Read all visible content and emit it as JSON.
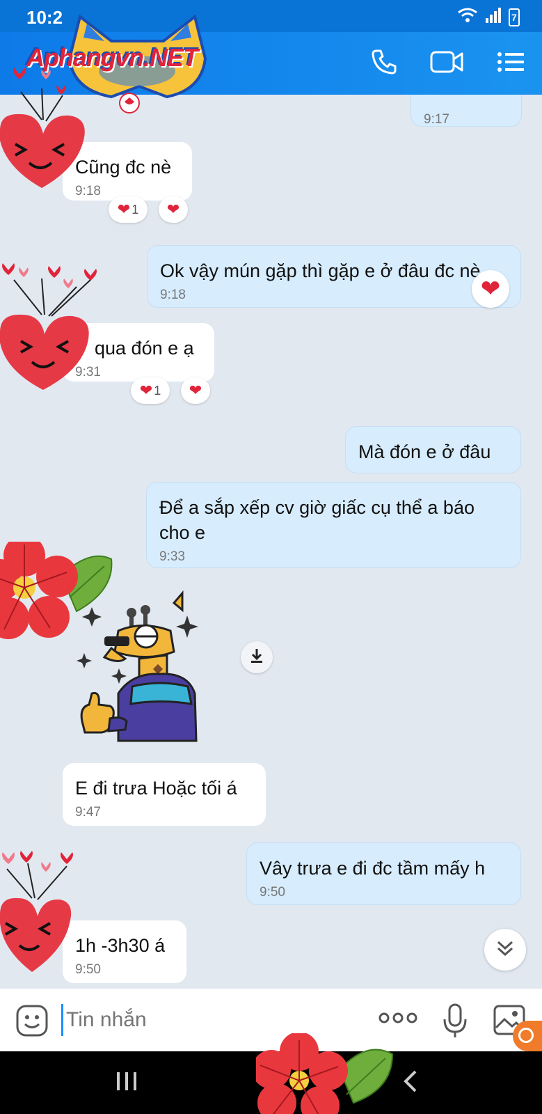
{
  "status": {
    "time": "10:2",
    "battery": "7"
  },
  "header": {
    "watermark": "Aphangvn.NET"
  },
  "messages": [
    {
      "id": "m0",
      "dir": "out",
      "text": "",
      "time": "9:17"
    },
    {
      "id": "m1",
      "dir": "in",
      "text": "Cũng đc nè",
      "time": "9:18",
      "reactions": [
        {
          "emoji": "heart",
          "count": "1"
        },
        {
          "emoji": "heart",
          "count": ""
        }
      ]
    },
    {
      "id": "m2",
      "dir": "out",
      "text": "Ok vậy mún gặp thì gặp e ở đâu đc nè",
      "time": "9:18",
      "reactions": [
        {
          "emoji": "heart",
          "count": ""
        }
      ]
    },
    {
      "id": "m3",
      "dir": "in",
      "text": "qua đón e ạ",
      "time": "9:31",
      "reactions": [
        {
          "emoji": "heart",
          "count": "1"
        },
        {
          "emoji": "heart",
          "count": ""
        }
      ]
    },
    {
      "id": "m4",
      "dir": "out",
      "text": "Mà đón e ở đâu",
      "time": ""
    },
    {
      "id": "m5",
      "dir": "out",
      "text": "Để a sắp xếp cv giờ giấc cụ thể a báo cho e",
      "time": "9:33"
    },
    {
      "id": "m6",
      "dir": "in",
      "type": "sticker",
      "sticker": "giraffe-thumbs-up-sticker"
    },
    {
      "id": "m7",
      "dir": "in",
      "text": "E đi trưa Hoặc tối á",
      "time": "9:47"
    },
    {
      "id": "m8",
      "dir": "out",
      "text": "Vây trưa e đi đc tầm mấy h",
      "time": "9:50"
    },
    {
      "id": "m9",
      "dir": "in",
      "text": "1h -3h30 á",
      "time": "9:50"
    }
  ],
  "input": {
    "placeholder": "Tin nhắn"
  },
  "colors": {
    "header": "#0d7ae8",
    "bubble_out": "#d7ecfc",
    "bubble_in": "#ffffff",
    "heart": "#e0243a"
  }
}
